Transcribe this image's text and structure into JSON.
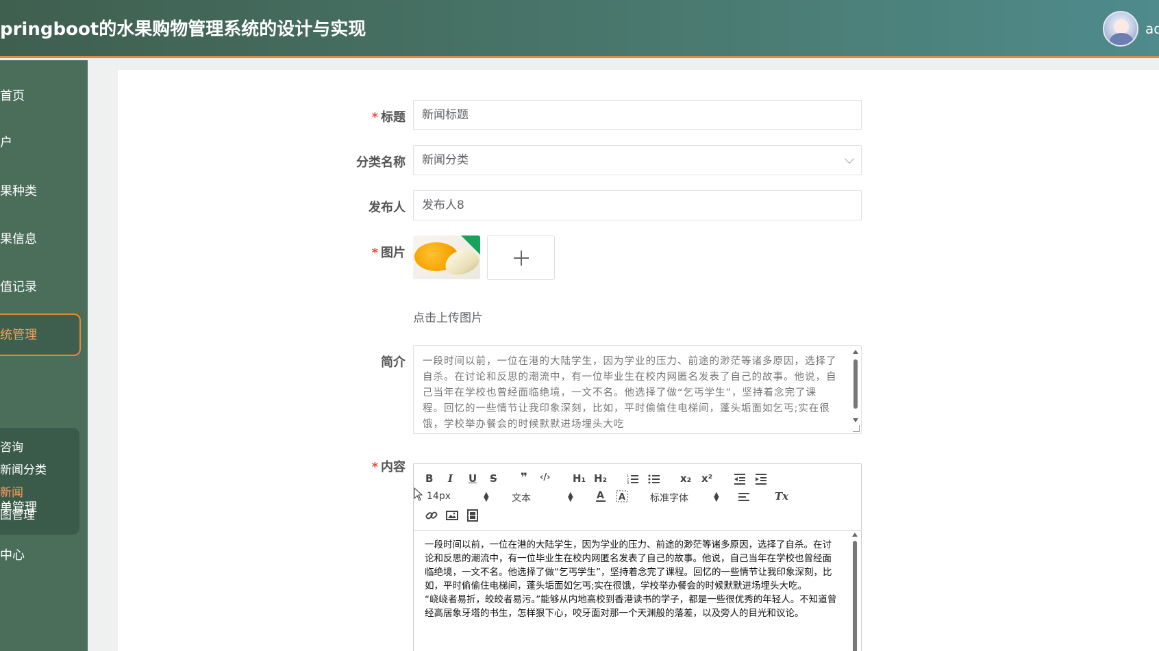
{
  "header": {
    "title": "pringboot的水果购物管理系统的设计与实现",
    "username": "ad"
  },
  "sidebar": {
    "items": [
      {
        "label": "首页"
      },
      {
        "label": "户"
      },
      {
        "label": "果种类"
      },
      {
        "label": "果信息"
      },
      {
        "label": "值记录"
      },
      {
        "label": "统管理"
      },
      {
        "label": "单管理"
      },
      {
        "label": "中心"
      }
    ],
    "submenu": [
      {
        "label": "咨询"
      },
      {
        "label": "新闻分类"
      },
      {
        "label": "新闻"
      },
      {
        "label": "图管理"
      }
    ]
  },
  "form": {
    "title_label": "标题",
    "title_value": "新闻标题",
    "category_label": "分类名称",
    "category_value": "新闻分类",
    "publisher_label": "发布人",
    "publisher_value": "发布人8",
    "image_label": "图片",
    "upload_tip": "点击上传图片",
    "intro_label": "简介",
    "intro_text": "一段时间以前，一位在港的大陆学生，因为学业的压力、前途的渺茫等诸多原因，选择了自杀。在讨论和反思的潮流中，有一位毕业生在校内网匿名发表了自己的故事。他说，自己当年在学校也曾经面临绝境，一文不名。他选择了做“乞丐学生”，坚持着念完了课程。回忆的一些情节让我印象深刻，比如，平时偷偷住电梯间，蓬头垢面如乞丐;实在很饿，学校举办餐会的时候默默进场埋头大吃",
    "content_label": "内容"
  },
  "editor": {
    "toolbar": {
      "bold": "B",
      "italic": "I",
      "underline": "U",
      "strike": "S",
      "quote": "❞",
      "code": "‹/›",
      "h1": "H₁",
      "h2": "H₂",
      "subscript": "x₂",
      "superscript": "x²",
      "size": "14px",
      "header_select": "文本",
      "font_select": "标准字体",
      "clean": "Tx"
    },
    "paragraphs": [
      "一段时间以前，一位在港的大陆学生，因为学业的压力、前途的渺茫等诸多原因，选择了自杀。在讨论和反思的潮流中，有一位毕业生在校内网匿名发表了自己的故事。他说，自己当年在学校也曾经面临绝境，一文不名。他选择了做“乞丐学生”，坚持着念完了课程。回忆的一些情节让我印象深刻，比如，平时偷偷住电梯间，蓬头垢面如乞丐;实在很饿，学校举办餐会的时候默默进场埋头大吃。",
      "“峣峣者易折，皎皎者易污。”能够从内地高校到香港读书的学子，都是一些很优秀的年轻人。不知道曾经高居象牙塔的书生，怎样狠下心，咬牙面对那一个天渊般的落差，以及旁人的目光和议论。"
    ]
  },
  "colors": {
    "header_start": "#3f5f4f",
    "header_end": "#4f8b8c",
    "accent": "#e8893a",
    "sidebar": "#4a6e5a",
    "required": "#e74c3c"
  }
}
